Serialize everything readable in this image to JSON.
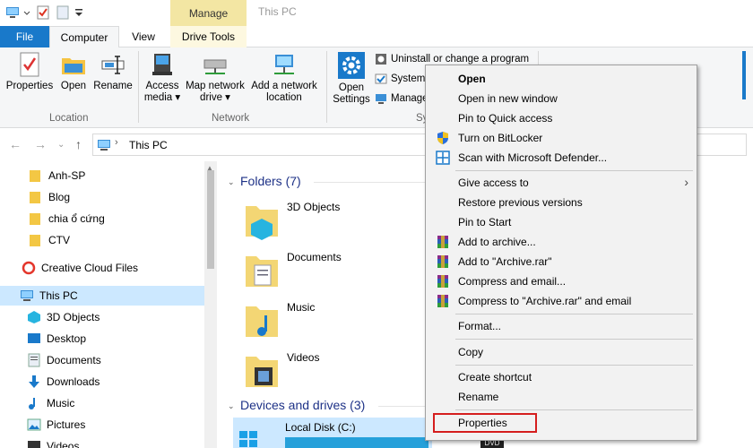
{
  "titlebar": {
    "manage_label": "Manage",
    "window_title": "This PC"
  },
  "tabs": {
    "file": "File",
    "computer": "Computer",
    "view": "View",
    "drive_tools": "Drive Tools"
  },
  "ribbon": {
    "location": {
      "properties": "Properties",
      "open": "Open",
      "rename": "Rename",
      "group": "Location"
    },
    "network": {
      "access_media_1": "Access",
      "access_media_2": "media ▾",
      "map_drive_1": "Map network",
      "map_drive_2": "drive ▾",
      "add_location_1": "Add a network",
      "add_location_2": "location",
      "group": "Network"
    },
    "system": {
      "open_settings_1": "Open",
      "open_settings_2": "Settings",
      "uninstall": "Uninstall or change a program",
      "system_props": "System",
      "manage": "Manage",
      "group_partial": "Sy"
    }
  },
  "address": {
    "path": "This PC"
  },
  "nav": {
    "items": [
      "Anh-SP",
      "Blog",
      "chia ổ cứng",
      "CTV",
      "Creative Cloud Files",
      "This PC",
      "3D Objects",
      "Desktop",
      "Documents",
      "Downloads",
      "Music",
      "Pictures",
      "Videos"
    ]
  },
  "content": {
    "folders_head": "Folders (7)",
    "folders": [
      "3D Objects",
      "Documents",
      "Music",
      "Videos"
    ],
    "drives_head": "Devices and drives (3)",
    "drive_c": "Local Disk (C:)",
    "dvd_label": "DVD"
  },
  "menu": {
    "open": "Open",
    "open_new_window": "Open in new window",
    "pin_quick": "Pin to Quick access",
    "bitlocker": "Turn on BitLocker",
    "defender": "Scan with Microsoft Defender...",
    "give_access": "Give access to",
    "restore": "Restore previous versions",
    "pin_start": "Pin to Start",
    "add_archive": "Add to archive...",
    "add_archive_rar": "Add to \"Archive.rar\"",
    "compress_email": "Compress and email...",
    "compress_rar_email": "Compress to \"Archive.rar\" and email",
    "format": "Format...",
    "copy": "Copy",
    "create_shortcut": "Create shortcut",
    "rename": "Rename",
    "properties": "Properties"
  },
  "colors": {
    "accent": "#1979ca",
    "manage_tab": "#f3e6a3",
    "highlight": "#d51e1e",
    "section_head": "#1e3287",
    "nav_selected": "#cce8ff"
  }
}
